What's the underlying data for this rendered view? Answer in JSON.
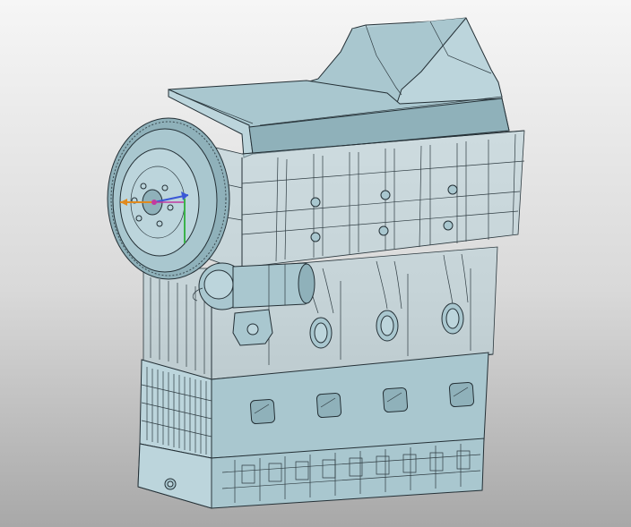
{
  "viewport": {
    "background_top": "#f6f6f6",
    "background_bottom": "#a8a8a8"
  },
  "model": {
    "shaded_color": "#a9c7cf",
    "edge_color": "#243036",
    "icon_name": "engine-block-3d-model"
  },
  "triad": {
    "x_color": "#e08a1e",
    "y_color": "#3bb24a",
    "z_color": "#3a57d6",
    "origin_color": "#c23aa0"
  }
}
